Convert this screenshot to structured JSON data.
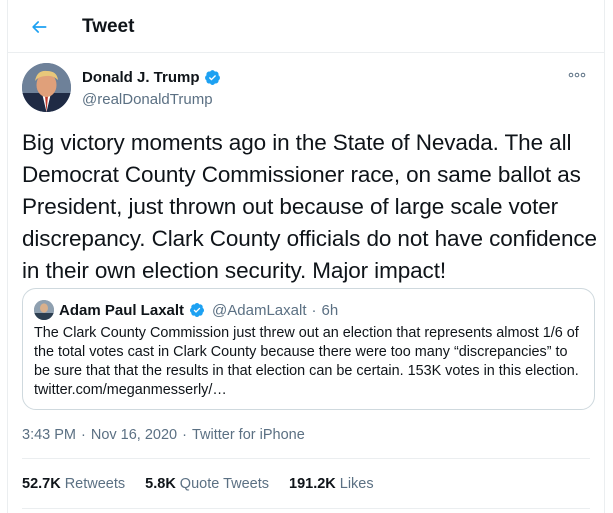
{
  "header": {
    "title": "Tweet",
    "back_icon": "arrow-left-icon"
  },
  "author": {
    "name": "Donald J. Trump",
    "handle": "@realDonaldTrump",
    "verified": true
  },
  "tweet": {
    "text": "Big victory moments ago in the State of Nevada. The all Democrat County Commissioner race, on same ballot as President, just thrown out because of large scale voter discrepancy. Clark County officials do not have confidence in their own election security. Major impact!"
  },
  "quote": {
    "name": "Adam Paul Laxalt",
    "handle": "@AdamLaxalt",
    "separator": "·",
    "time": "6h",
    "verified": true,
    "text": "The Clark County Commission just threw out an election that represents almost 1/6 of the total votes cast in Clark County because there were too many “discrepancies” to be sure that that the results in that election can be certain. 153K votes in this election. twitter.com/meganmesserly/…"
  },
  "meta": {
    "time": "3:43 PM",
    "separator": "·",
    "date": "Nov 16, 2020",
    "source": "Twitter for iPhone"
  },
  "stats": {
    "retweets_count": "52.7K",
    "retweets_label": "Retweets",
    "quotes_count": "5.8K",
    "quotes_label": "Quote Tweets",
    "likes_count": "191.2K",
    "likes_label": "Likes"
  },
  "colors": {
    "accent": "#1da1f2",
    "secondary_text": "#5b7083",
    "border": "#ebeef0"
  }
}
